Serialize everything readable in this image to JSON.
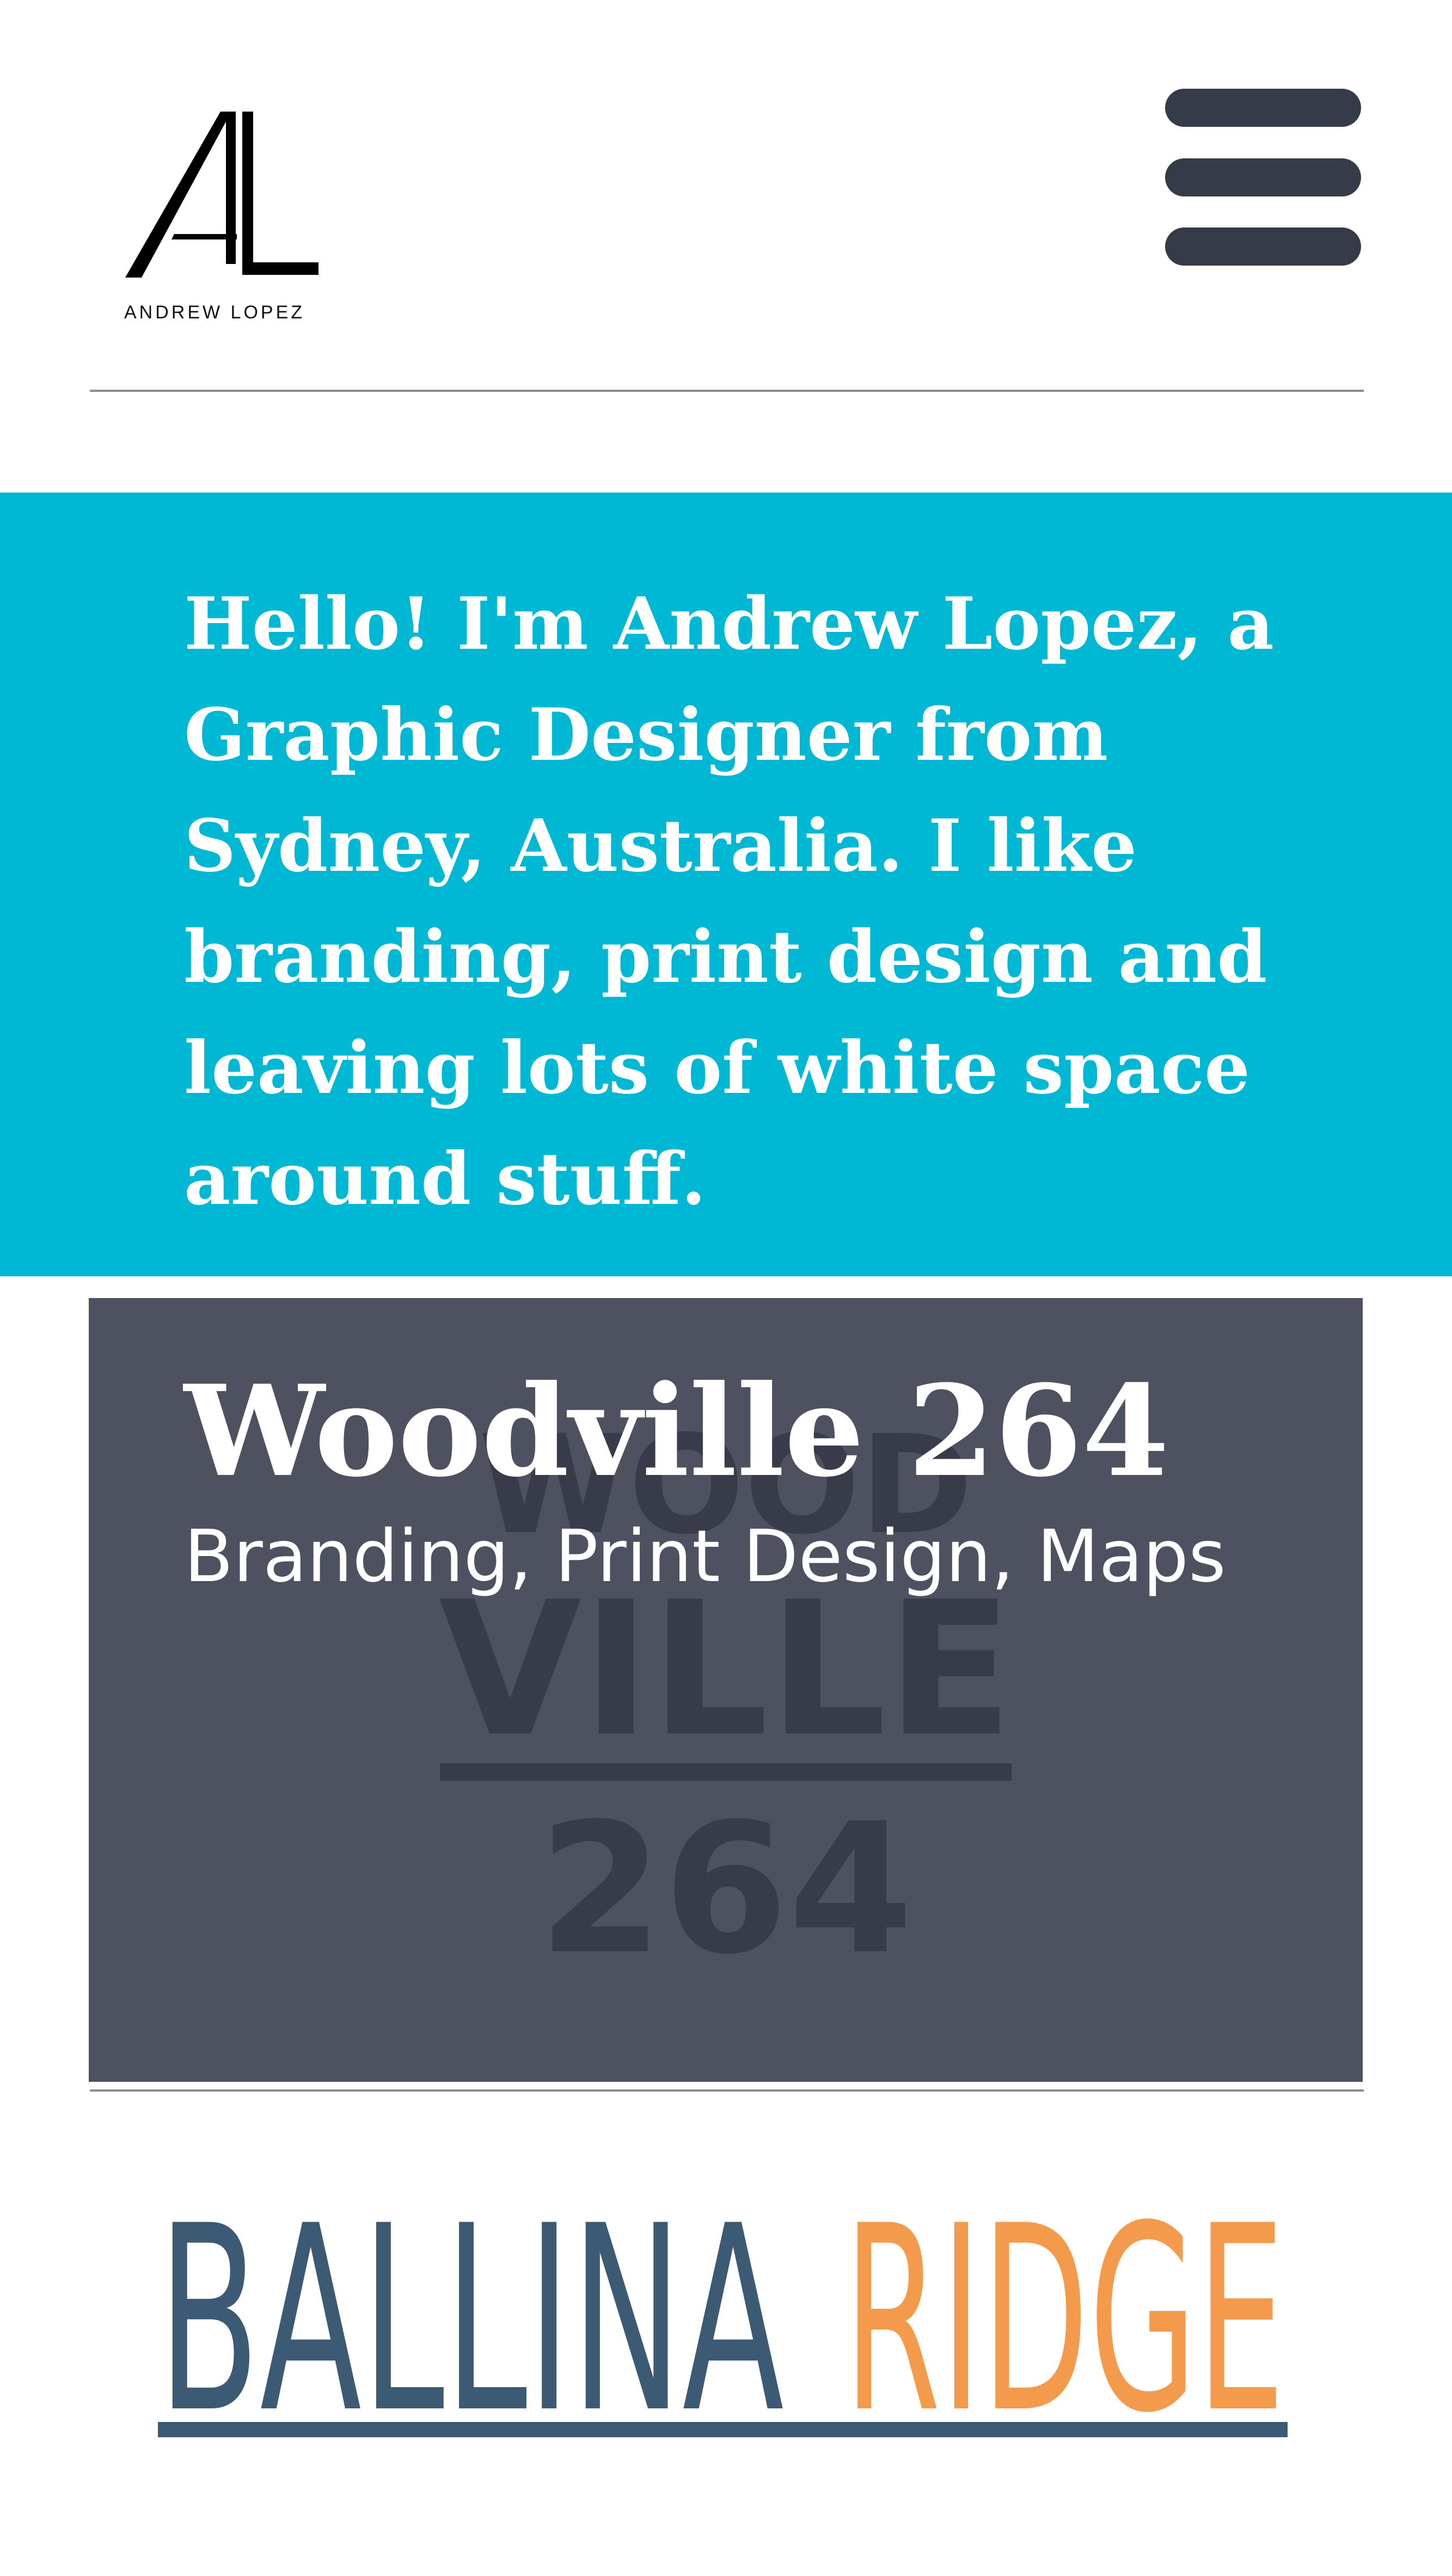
{
  "header": {
    "logo_text": "ANDREW LOPEZ",
    "menu_icon": "hamburger-menu-icon"
  },
  "intro": {
    "text": "Hello! I'm Andrew Lopez, a Graphic Designer from Sydney, Australia. I like branding, print design and leaving lots of white space around stuff."
  },
  "projects": [
    {
      "title": "Woodville 264",
      "tags": "Branding, Print Design, Maps",
      "watermark_lines": [
        "WOOD",
        "VILLE",
        "264"
      ]
    },
    {
      "logo_words": [
        "BALLINA",
        "RIDGE"
      ]
    }
  ],
  "colors": {
    "accent": "#00b8d4",
    "card_background": "#4e5260",
    "menu_icon": "#363b48",
    "ballina_blue": "#3d5a75",
    "ridge_orange": "#f49a4c"
  }
}
